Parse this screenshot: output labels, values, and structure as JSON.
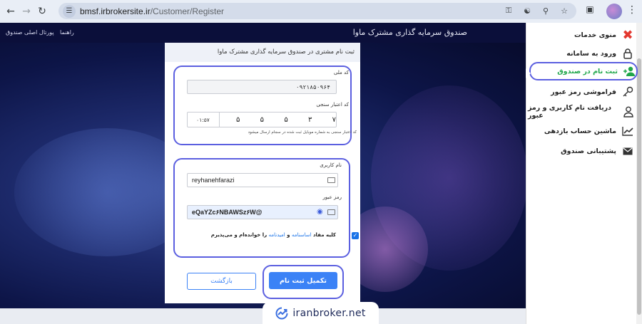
{
  "browser": {
    "url_host": "bmsf.irbrokersite.ir",
    "url_path": "/Customer/Register"
  },
  "header": {
    "brand": "صندوق سرمایه گذاری مشترک ماوا",
    "help": "راهنما",
    "portal": "پورتال اصلی صندوق"
  },
  "sidebar": {
    "items": [
      {
        "label": "منوی خدمات",
        "icon": "close-icon"
      },
      {
        "label": "ورود به سامانه",
        "icon": "lock-icon"
      },
      {
        "label": "ثبت نام در صندوق",
        "icon": "add-user-icon"
      },
      {
        "label": "فراموشی رمز عبور",
        "icon": "key-icon"
      },
      {
        "label": "دریافت نام کاربری و رمز عبور",
        "icon": "user-icon"
      },
      {
        "label": "ماشین حساب بازدهی",
        "icon": "chart-icon"
      },
      {
        "label": "پشتیبانی صندوق",
        "icon": "mail-icon"
      }
    ]
  },
  "form": {
    "title": "ثبت نام مشتری در صندوق سرمایه گذاری مشترک ماوا",
    "national_code_label": "کد ملی",
    "national_code_value": "۰۹۲۱۸۵۰۹۶۴",
    "verify_code_label": "کد اعتبار سنجی",
    "verify_digits": [
      "۷",
      "۳",
      "۵",
      "۵",
      "۵"
    ],
    "timer": "۰۱:۵۷",
    "verify_hint": "کد اعتبار سنجی به شماره موبایل ثبت شده در سجام ارسال میشود",
    "username_label": "نام کاربری",
    "username_value": "reyhanehfarazi",
    "password_label": "رمز عبور",
    "password_value": "eQaYZc۶NBAWSz۶W@",
    "agree_prefix": "کلیه مفاد",
    "agree_link1": "اساسنامه",
    "agree_and": "و",
    "agree_link2": "امیدنامه",
    "agree_suffix": "را خوانده‌ام و می‌پذیرم",
    "agree_checked": true,
    "submit_label": "تکمیل ثبت نام",
    "back_label": "بازگشت"
  },
  "watermark": {
    "text": "iranbroker.net"
  },
  "colors": {
    "accent": "#5b5fe0",
    "primary": "#3b82f6",
    "active_green": "#1fa64a",
    "close_red": "#e3382f"
  }
}
